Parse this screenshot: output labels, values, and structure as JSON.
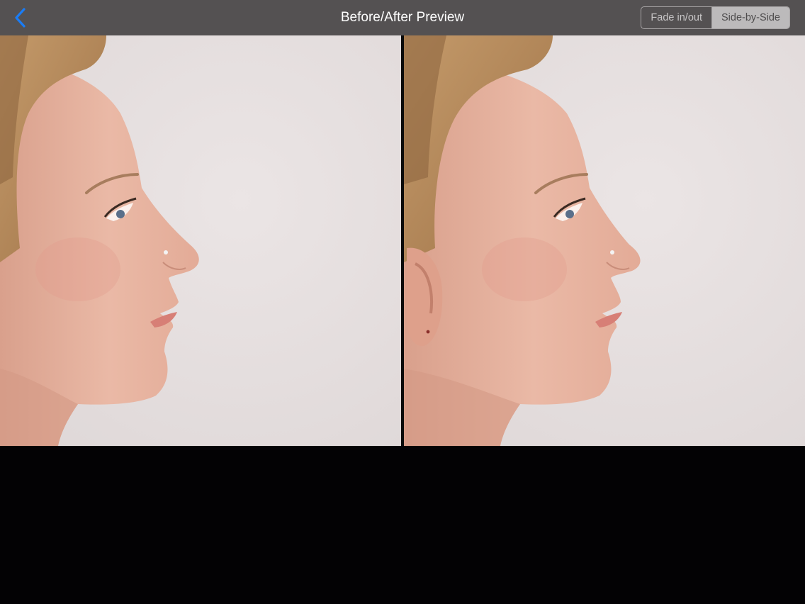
{
  "navbar": {
    "title": "Before/After Preview",
    "back_icon": "chevron-left-icon",
    "back_color": "#1a7cf5",
    "background": "#545152"
  },
  "mode_switch": {
    "options": [
      "Fade in/out",
      "Side-by-Side"
    ],
    "selected": "Side-by-Side"
  },
  "photos": {
    "before": {
      "subject": "woman profile facing right, original nose"
    },
    "after": {
      "subject": "woman profile facing right, refined nose"
    },
    "skin_color": "#e6b39f",
    "hair_color": "#b58b5c",
    "backdrop_color": "#e7e1e1"
  }
}
